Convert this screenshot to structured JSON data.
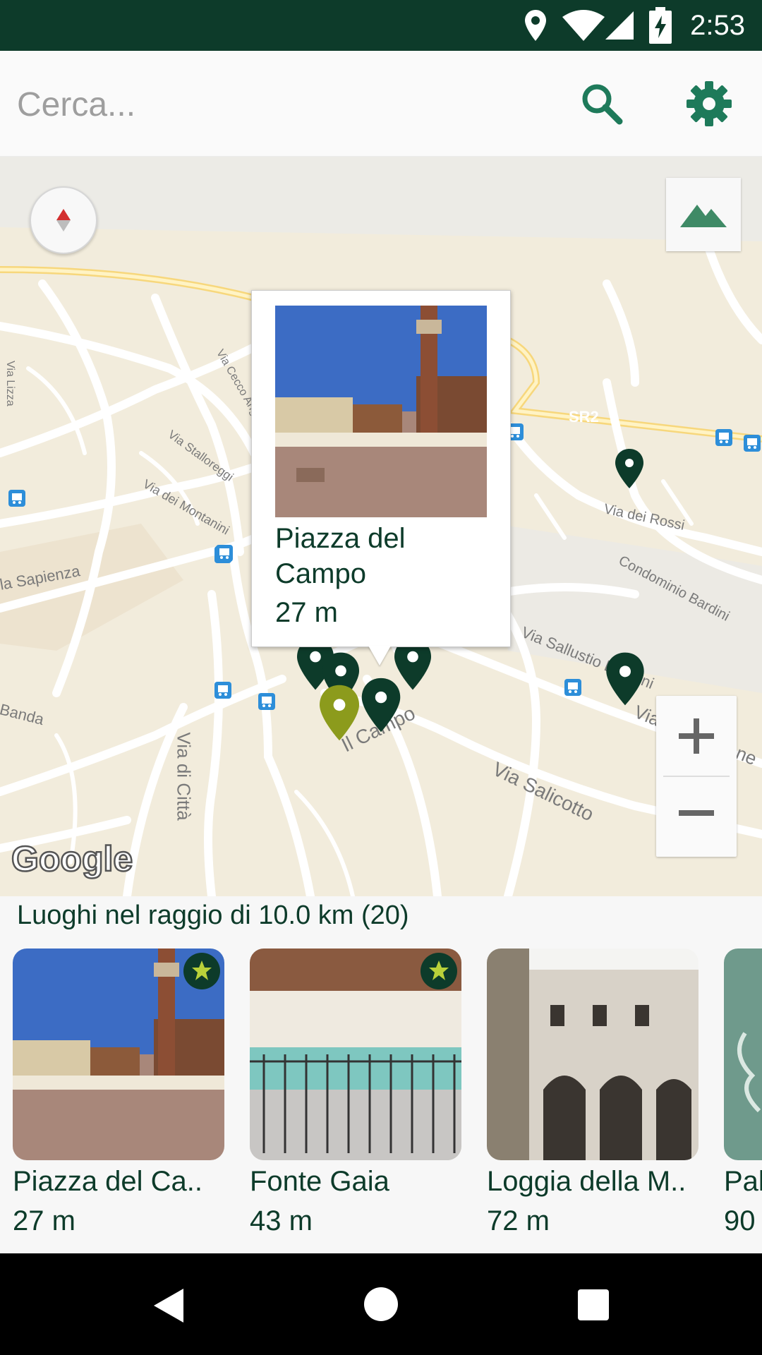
{
  "status_bar": {
    "time": "2:53",
    "icons": [
      "location-icon",
      "wifi-icon",
      "signal-icon",
      "battery-charging-icon"
    ]
  },
  "search": {
    "placeholder": "Cerca...",
    "value": "",
    "search_icon": "search-icon",
    "settings_icon": "gear-icon"
  },
  "map": {
    "compass_icon": "compass-icon",
    "terrain_icon": "terrain-icon",
    "zoom_in": "+",
    "zoom_out": "−",
    "google_logo": "Google",
    "road_labels": [
      "SR2",
      "Via dei Rossi",
      "Condominio Bardini",
      "Via Sallustio Bandini",
      "Via Salicotto",
      "Il Campo",
      "Via di Città",
      "Via del Porrione",
      "Via dei Montanini",
      "Via Sallustio Bandini",
      "Via Stalloreggi",
      "la Sapienza",
      "Via Lizza",
      "Via Cecco Angiolieri",
      "Banda"
    ],
    "info_window": {
      "title": "Piazza del Campo",
      "distance": "27 m"
    }
  },
  "places": {
    "title": "Luoghi nel raggio di 10.0 km (20)",
    "items": [
      {
        "name": "Piazza del Ca..",
        "distance": "27 m",
        "favorite": true
      },
      {
        "name": "Fonte Gaia",
        "distance": "43 m",
        "favorite": true
      },
      {
        "name": "Loggia della M..",
        "distance": "72 m",
        "favorite": false
      },
      {
        "name": "Pal",
        "distance": "90",
        "favorite": false
      }
    ]
  },
  "colors": {
    "primary": "#0d3b2a",
    "accent_marker": "#8c9b1c",
    "icon_green": "#1e7a5a"
  },
  "nav_bar": {
    "back_icon": "back-icon",
    "home_icon": "home-icon",
    "recents_icon": "recents-icon"
  }
}
